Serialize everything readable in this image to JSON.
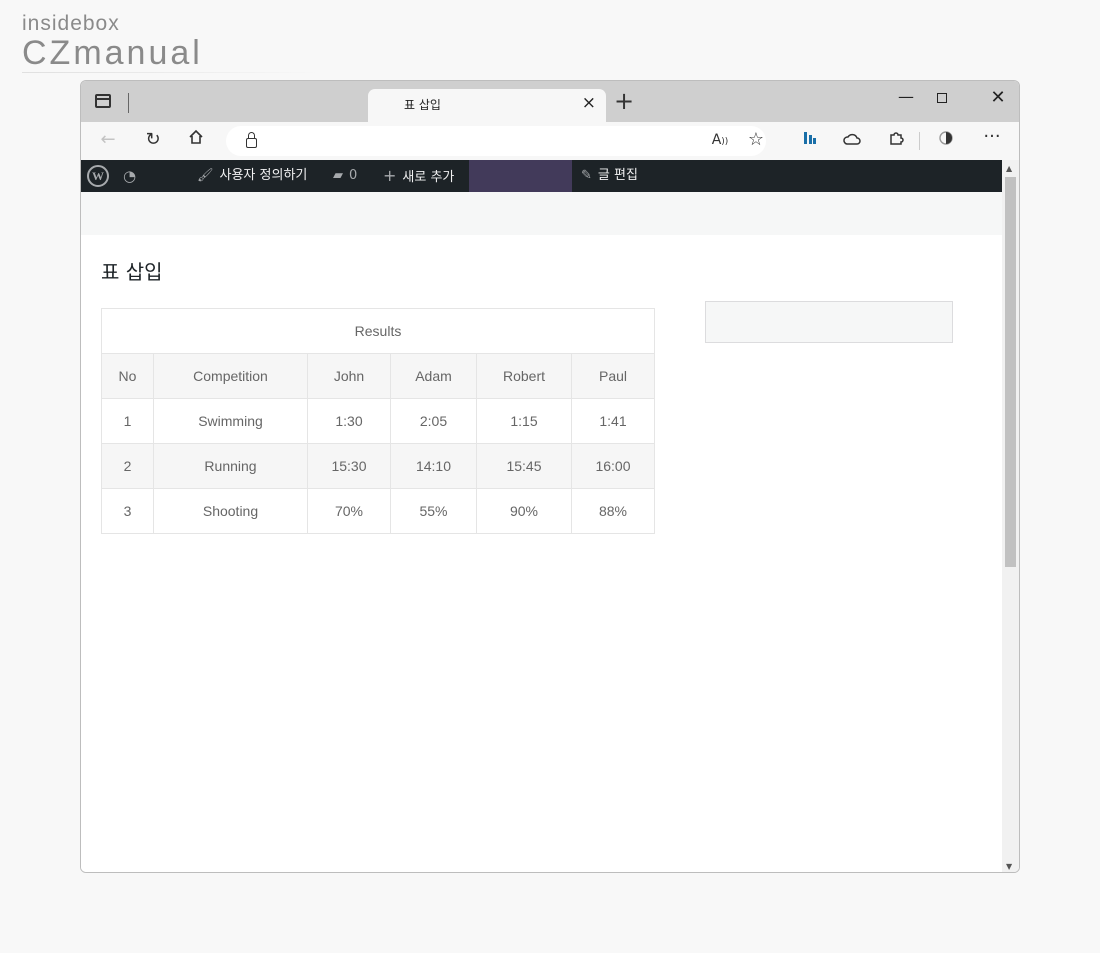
{
  "logo": {
    "top": "insidebox",
    "main": "CZmanual"
  },
  "browser": {
    "tab_title": "표 삽입",
    "new_tab_glyph": "+",
    "close_glyph": "×"
  },
  "wp_toolbar": {
    "customize_label": "사용자 정의하기",
    "comments_count": "0",
    "new_label": "새로 추가",
    "edit_label": "글 편집"
  },
  "page": {
    "title": "표 삽입"
  },
  "table": {
    "caption": "Results",
    "headers": [
      "No",
      "Competition",
      "John",
      "Adam",
      "Robert",
      "Paul"
    ],
    "rows": [
      [
        "1",
        "Swimming",
        "1:30",
        "2:05",
        "1:15",
        "1:41"
      ],
      [
        "2",
        "Running",
        "15:30",
        "14:10",
        "15:45",
        "16:00"
      ],
      [
        "3",
        "Shooting",
        "70%",
        "55%",
        "90%",
        "88%"
      ]
    ]
  },
  "colors": {
    "wp_admin_bar": "#1d2327",
    "highlight": "#423a5a"
  }
}
